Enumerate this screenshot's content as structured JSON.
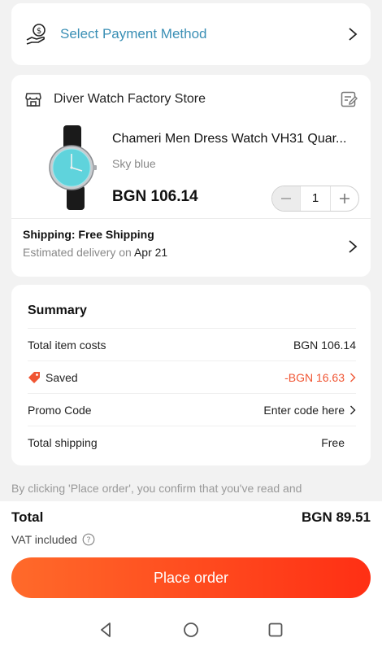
{
  "payment": {
    "label": "Select Payment Method",
    "icon": "money-hand-icon"
  },
  "store": {
    "name": "Diver Watch Factory Store",
    "product": {
      "title": "Chameri Men Dress Watch VH31 Quar...",
      "variant": "Sky blue",
      "price": "BGN 106.14",
      "quantity": "1"
    },
    "shipping": {
      "title": "Shipping: Free Shipping",
      "sub_prefix": "Estimated delivery on",
      "date": "Apr 21"
    }
  },
  "summary": {
    "title": "Summary",
    "rows": [
      {
        "label": "Total item costs",
        "value": "BGN 106.14"
      },
      {
        "label": "Saved",
        "value": "-BGN 16.63"
      },
      {
        "label": "Promo Code",
        "value": "Enter code here"
      },
      {
        "label": "Total shipping",
        "value": "Free"
      }
    ]
  },
  "disclaimer": "By clicking 'Place order', you confirm that you've read and",
  "footer": {
    "total_label": "Total",
    "total_value": "BGN 89.51",
    "vat_label": "VAT included",
    "cta_label": "Place order"
  },
  "colors": {
    "accent": "#ff4a1f",
    "link": "#3a8fb5",
    "saved": "#f05533"
  }
}
